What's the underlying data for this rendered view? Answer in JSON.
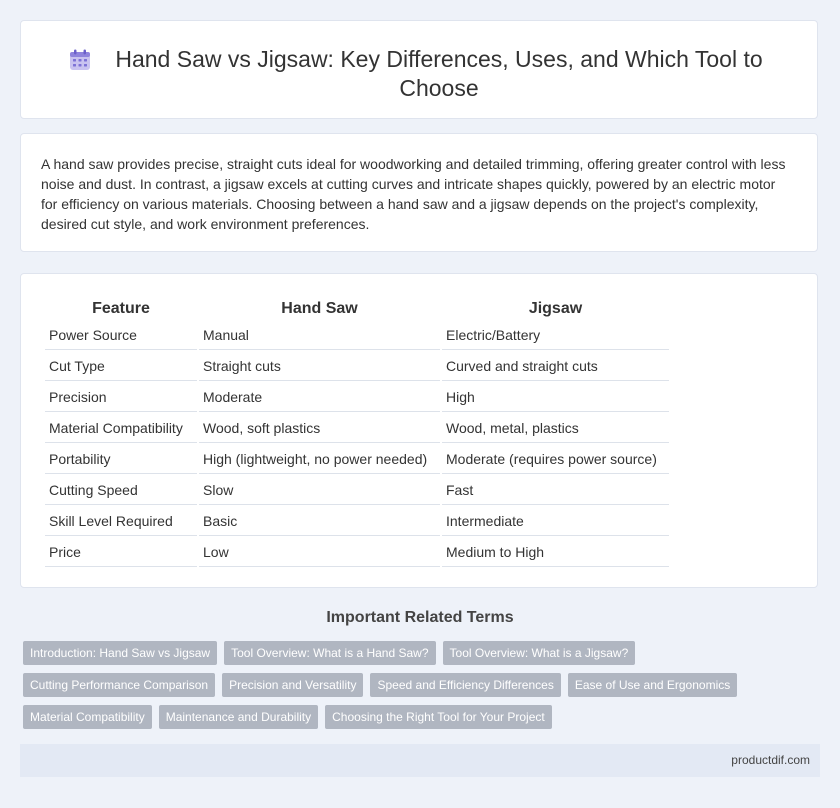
{
  "header": {
    "title": "Hand Saw vs Jigsaw: Key Differences, Uses, and Which Tool to Choose",
    "icon": "calendar-icon"
  },
  "intro": {
    "text": "A hand saw provides precise, straight cuts ideal for woodworking and detailed trimming, offering greater control with less noise and dust. In contrast, a jigsaw excels at cutting curves and intricate shapes quickly, powered by an electric motor for efficiency on various materials. Choosing between a hand saw and a jigsaw depends on the project's complexity, desired cut style, and work environment preferences."
  },
  "table": {
    "headers": [
      "Feature",
      "Hand Saw",
      "Jigsaw"
    ],
    "rows": [
      [
        "Power Source",
        "Manual",
        "Electric/Battery"
      ],
      [
        "Cut Type",
        "Straight cuts",
        "Curved and straight cuts"
      ],
      [
        "Precision",
        "Moderate",
        "High"
      ],
      [
        "Material Compatibility",
        "Wood, soft plastics",
        "Wood, metal, plastics"
      ],
      [
        "Portability",
        "High (lightweight, no power needed)",
        "Moderate (requires power source)"
      ],
      [
        "Cutting Speed",
        "Slow",
        "Fast"
      ],
      [
        "Skill Level Required",
        "Basic",
        "Intermediate"
      ],
      [
        "Price",
        "Low",
        "Medium to High"
      ]
    ]
  },
  "related": {
    "title": "Important Related Terms",
    "rows": [
      [
        "Introduction: Hand Saw vs Jigsaw",
        "Tool Overview: What is a Hand Saw?",
        "Tool Overview: What is a Jigsaw?"
      ],
      [
        "Cutting Performance Comparison",
        "Precision and Versatility",
        "Speed and Efficiency Differences",
        "Ease of Use and Ergonomics"
      ],
      [
        "Material Compatibility",
        "Maintenance and Durability",
        "Choosing the Right Tool for Your Project"
      ]
    ]
  },
  "footer": {
    "text": "productdif.com"
  }
}
